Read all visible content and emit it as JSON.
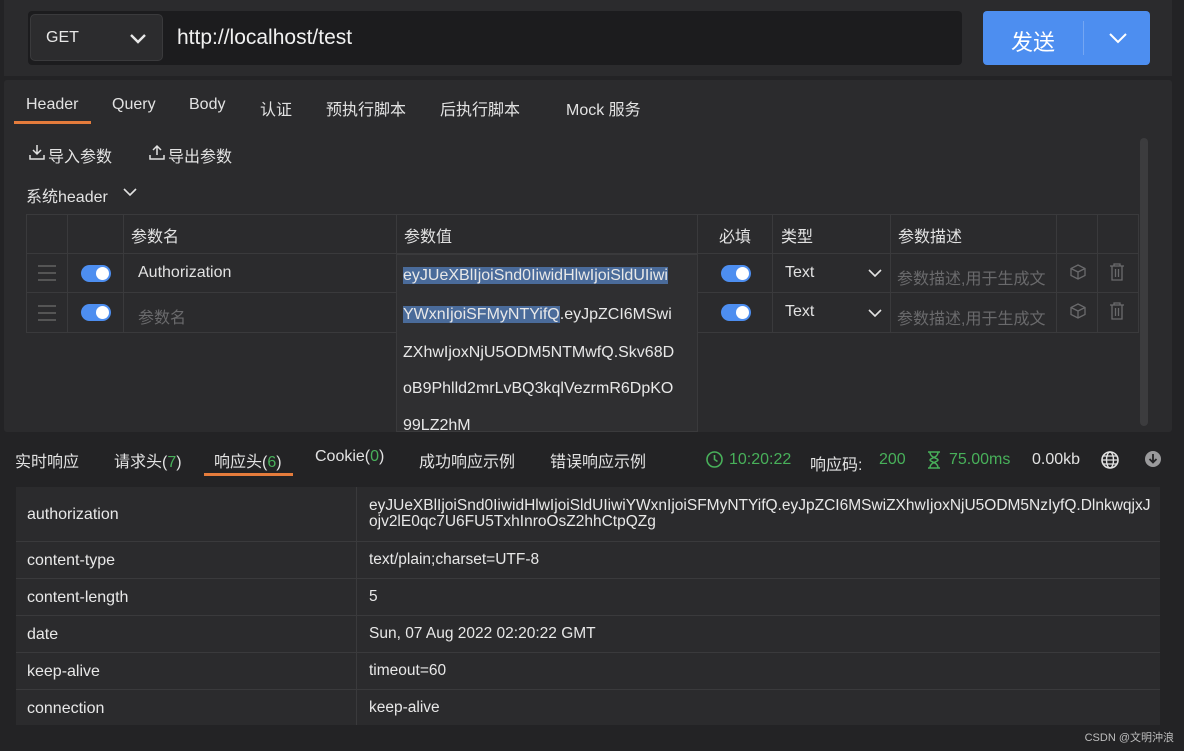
{
  "request": {
    "method": "GET",
    "url": "http://localhost/test",
    "send_label": "发送"
  },
  "tabs": [
    "Header",
    "Query",
    "Body",
    "认证",
    "预执行脚本",
    "后执行脚本",
    "Mock 服务"
  ],
  "actions": {
    "import": "导入参数",
    "export": "导出参数"
  },
  "system_header": "系统header",
  "params_table": {
    "headers": [
      "参数名",
      "参数值",
      "必填",
      "类型",
      "参数描述"
    ],
    "rows": [
      {
        "name": "Authorization",
        "name_placeholder": "",
        "type": "Text",
        "desc_placeholder": "参数描述,用于生成文",
        "enabled": true,
        "required": true
      },
      {
        "name": "",
        "name_placeholder": "参数名",
        "type": "Text",
        "desc_placeholder": "参数描述,用于生成文",
        "enabled": true,
        "required": true
      }
    ]
  },
  "value_popup": {
    "lines": [
      {
        "selected": "eyJUeXBlIjoiSnd0IiwidHlwIjoiSldUIiwi",
        "rest": ""
      },
      {
        "selected": "YWxnIjoiSFMyNTYifQ",
        "rest": ".eyJpZCI6MSwi"
      },
      {
        "selected": "",
        "rest": "ZXhwIjoxNjU5ODM5NTMwfQ.Skv68D"
      },
      {
        "selected": "",
        "rest": "oB9Phlld2mrLvBQ3kqlVezrmR6DpKO"
      },
      {
        "selected": "",
        "rest": "99LZ2hM"
      }
    ]
  },
  "response": {
    "tabs": {
      "realtime": "实时响应",
      "req_headers": "请求头(",
      "req_headers_count": "7",
      "resp_headers": "响应头(",
      "resp_headers_count": "6",
      "cookie": "Cookie(",
      "cookie_count": "0",
      "success_example": "成功响应示例",
      "error_example": "错误响应示例",
      "close_paren": ")"
    },
    "time": "10:20:22",
    "status_label": "响应码:",
    "status_code": "200",
    "duration": "75.00ms",
    "size": "0.00kb",
    "headers": [
      {
        "key": "authorization",
        "value": "eyJUeXBlIjoiSnd0IiwidHlwIjoiSldUIiwiYWxnIjoiSFMyNTYifQ.eyJpZCI6MSwiZXhwIjoxNjU5ODM5NzIyfQ.DlnkwqjxJojv2lE0qc7U6FU5TxhInroOsZ2hhCtpQZg"
      },
      {
        "key": "content-type",
        "value": "text/plain;charset=UTF-8"
      },
      {
        "key": "content-length",
        "value": "5"
      },
      {
        "key": "date",
        "value": "Sun, 07 Aug 2022 02:20:22 GMT"
      },
      {
        "key": "keep-alive",
        "value": "timeout=60"
      },
      {
        "key": "connection",
        "value": "keep-alive"
      }
    ]
  },
  "watermark": "CSDN @文明沖浪",
  "colors": {
    "accent": "#4d8ef0",
    "tab_underline": "#e57c3c",
    "success": "#48b05a"
  }
}
